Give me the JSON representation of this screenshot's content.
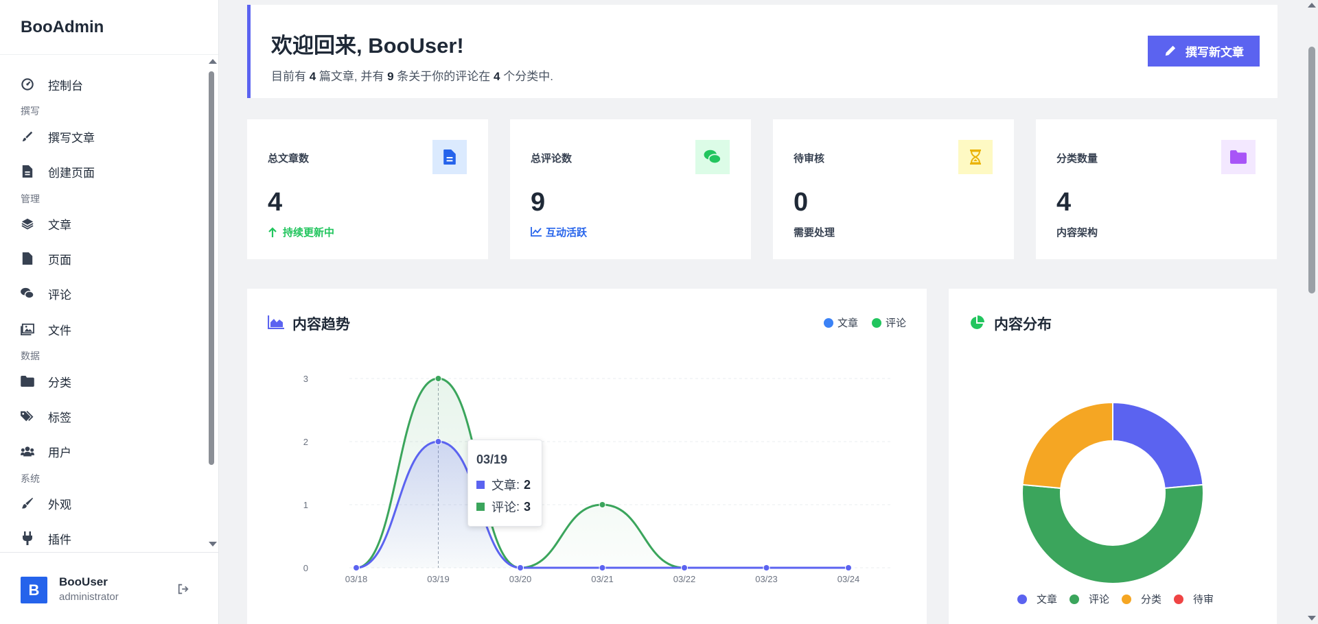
{
  "app": {
    "brand": "BooAdmin"
  },
  "sidebar": {
    "items": [
      {
        "label": "控制台",
        "icon": "dashboard-icon"
      },
      {
        "section": "撰写"
      },
      {
        "label": "撰写文章",
        "icon": "brush-icon"
      },
      {
        "label": "创建页面",
        "icon": "file-plus-icon"
      },
      {
        "section": "管理"
      },
      {
        "label": "文章",
        "icon": "layers-icon"
      },
      {
        "label": "页面",
        "icon": "file-icon"
      },
      {
        "label": "评论",
        "icon": "comments-icon"
      },
      {
        "label": "文件",
        "icon": "image-icon"
      },
      {
        "section": "数据"
      },
      {
        "label": "分类",
        "icon": "folder-icon"
      },
      {
        "label": "标签",
        "icon": "tags-icon"
      },
      {
        "label": "用户",
        "icon": "users-icon"
      },
      {
        "section": "系统"
      },
      {
        "label": "外观",
        "icon": "paint-brush-icon"
      },
      {
        "label": "插件",
        "icon": "plug-icon"
      }
    ]
  },
  "user": {
    "initial": "B",
    "name": "BooUser",
    "role": "administrator"
  },
  "welcome": {
    "title": "欢迎回来, BooUser!",
    "text_a": "目前有 ",
    "posts": "4",
    "text_b": " 篇文章, 并有 ",
    "comments": "9",
    "text_c": " 条关于你的评论在 ",
    "categories": "4",
    "text_d": " 个分类中.",
    "button": "撰写新文章"
  },
  "stats": [
    {
      "label": "总文章数",
      "value": "4",
      "sub": "持续更新中",
      "sub_color": "#22c55e",
      "icon": "document-icon",
      "icon_bg": "#dbeafe",
      "icon_color": "#2563eb"
    },
    {
      "label": "总评论数",
      "value": "9",
      "sub": "互动活跃",
      "sub_color": "#2563eb",
      "icon": "chat-icon",
      "icon_bg": "#dcfce7",
      "icon_color": "#22c55e"
    },
    {
      "label": "待审核",
      "value": "0",
      "sub": "需要处理",
      "sub_color": "#374151",
      "icon": "hourglass-icon",
      "icon_bg": "#fef9c3",
      "icon_color": "#eab308"
    },
    {
      "label": "分类数量",
      "value": "4",
      "sub": "内容架构",
      "sub_color": "#374151",
      "icon": "folder-icon",
      "icon_bg": "#f3e8ff",
      "icon_color": "#a855f7"
    }
  ],
  "trend": {
    "title": "内容趋势",
    "legend": [
      {
        "name": "文章",
        "color": "#3b82f6"
      },
      {
        "name": "评论",
        "color": "#22c55e"
      }
    ],
    "tooltip": {
      "title": "03/19",
      "rows": [
        {
          "name": "文章",
          "value": "2"
        },
        {
          "name": "评论",
          "value": "3"
        }
      ]
    }
  },
  "distribution": {
    "title": "内容分布",
    "legend": [
      {
        "name": "文章",
        "color": "#5b63f0"
      },
      {
        "name": "评论",
        "color": "#3ba55c"
      },
      {
        "name": "分类",
        "color": "#f5a623"
      },
      {
        "name": "待审",
        "color": "#ef4444"
      }
    ]
  },
  "chart_data": [
    {
      "type": "area",
      "title": "内容趋势",
      "categories": [
        "03/18",
        "03/19",
        "03/20",
        "03/21",
        "03/22",
        "03/23",
        "03/24"
      ],
      "series": [
        {
          "name": "文章",
          "values": [
            0,
            2,
            0,
            0,
            0,
            0,
            0
          ],
          "color": "#5b63f0"
        },
        {
          "name": "评论",
          "values": [
            0,
            3,
            0,
            1,
            0,
            0,
            0
          ],
          "color": "#3ba55c"
        }
      ],
      "ylim": [
        0,
        3
      ],
      "yticks": [
        "0",
        "1",
        "2",
        "3"
      ],
      "grid": true,
      "legend": "top-right"
    },
    {
      "type": "pie",
      "title": "内容分布",
      "donut": true,
      "labels": [
        "文章",
        "评论",
        "分类",
        "待审"
      ],
      "values": [
        4,
        9,
        4,
        0
      ],
      "colors": [
        "#5b63f0",
        "#3ba55c",
        "#f5a623",
        "#ef4444"
      ],
      "legend": "bottom"
    }
  ]
}
